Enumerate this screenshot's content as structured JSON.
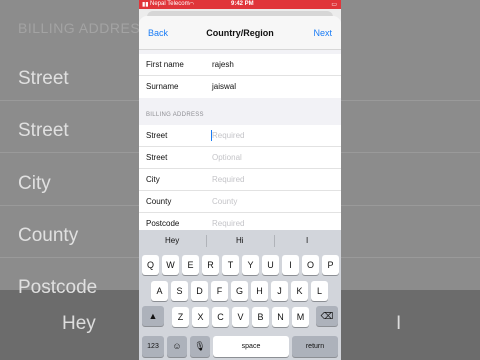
{
  "background": {
    "section_label": "BILLING ADDRESS",
    "rows": [
      "Street",
      "Street",
      "City",
      "County",
      "Postcode"
    ],
    "kbd_suggestions": [
      "Hey",
      "I"
    ]
  },
  "status_bar": {
    "carrier": "Nepal Telecom",
    "time": "9:42 PM"
  },
  "nav": {
    "back_label": "Back",
    "title": "Country/Region",
    "next_label": "Next"
  },
  "name_group": [
    {
      "label": "First name",
      "value": "rajesh"
    },
    {
      "label": "Surname",
      "value": "jaiswal"
    }
  ],
  "billing_header": "BILLING ADDRESS",
  "billing_group": [
    {
      "label": "Street",
      "placeholder": "Required"
    },
    {
      "label": "Street",
      "placeholder": "Optional"
    },
    {
      "label": "City",
      "placeholder": "Required"
    },
    {
      "label": "County",
      "placeholder": "County"
    },
    {
      "label": "Postcode",
      "placeholder": "Required"
    }
  ],
  "keyboard": {
    "suggestions": [
      "Hey",
      "Hi",
      "I"
    ],
    "row1": [
      "Q",
      "W",
      "E",
      "R",
      "T",
      "Y",
      "U",
      "I",
      "O",
      "P"
    ],
    "row2": [
      "A",
      "S",
      "D",
      "F",
      "G",
      "H",
      "J",
      "K",
      "L"
    ],
    "row3": [
      "Z",
      "X",
      "C",
      "V",
      "B",
      "N",
      "M"
    ],
    "shift_icon": "shift-icon",
    "delete_icon": "backspace-icon",
    "numbers_label": "123",
    "emoji_icon": "emoji-icon",
    "mic_icon": "microphone-icon",
    "space_label": "space",
    "return_label": "return"
  }
}
